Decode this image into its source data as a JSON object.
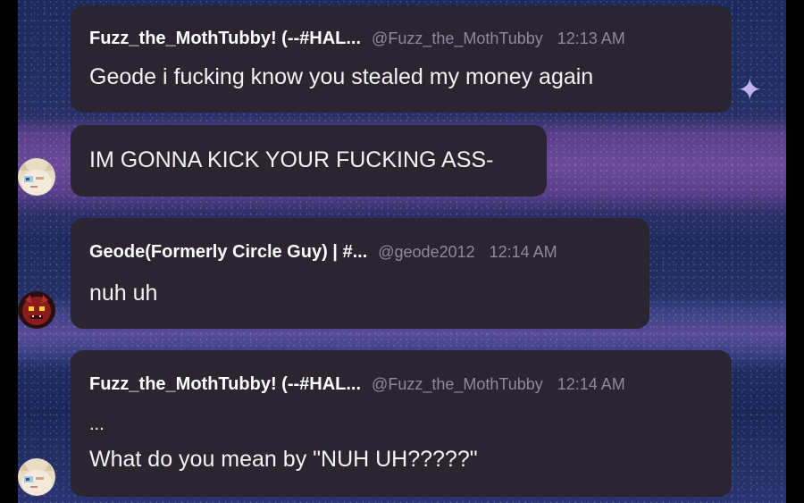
{
  "messages": [
    {
      "username": "Fuzz_the_MothTubby! (--#HAL...",
      "handle": "@Fuzz_the_MothTubby",
      "time": "12:13 AM",
      "lines": [
        "Geode i fucking know you stealed my money again"
      ]
    },
    {
      "lines": [
        "IM GONNA KICK YOUR FUCKING ASS-"
      ]
    },
    {
      "username": "Geode(Formerly Circle Guy) | #...",
      "handle": "@geode2012",
      "time": "12:14 AM",
      "lines": [
        "nuh uh"
      ]
    },
    {
      "username": "Fuzz_the_MothTubby! (--#HAL...",
      "handle": "@Fuzz_the_MothTubby",
      "time": "12:14 AM",
      "lines": [
        "...",
        "What do you mean by \"NUH UH?????\""
      ]
    }
  ],
  "colors": {
    "bubble": "#2a2530",
    "username": "#ffffff",
    "meta": "#8e8a97",
    "background_blue": "#1d2a5e",
    "background_purple": "#6a4a99"
  },
  "icons": [
    "sparkle-icon",
    "avatar-cat",
    "avatar-geode"
  ]
}
